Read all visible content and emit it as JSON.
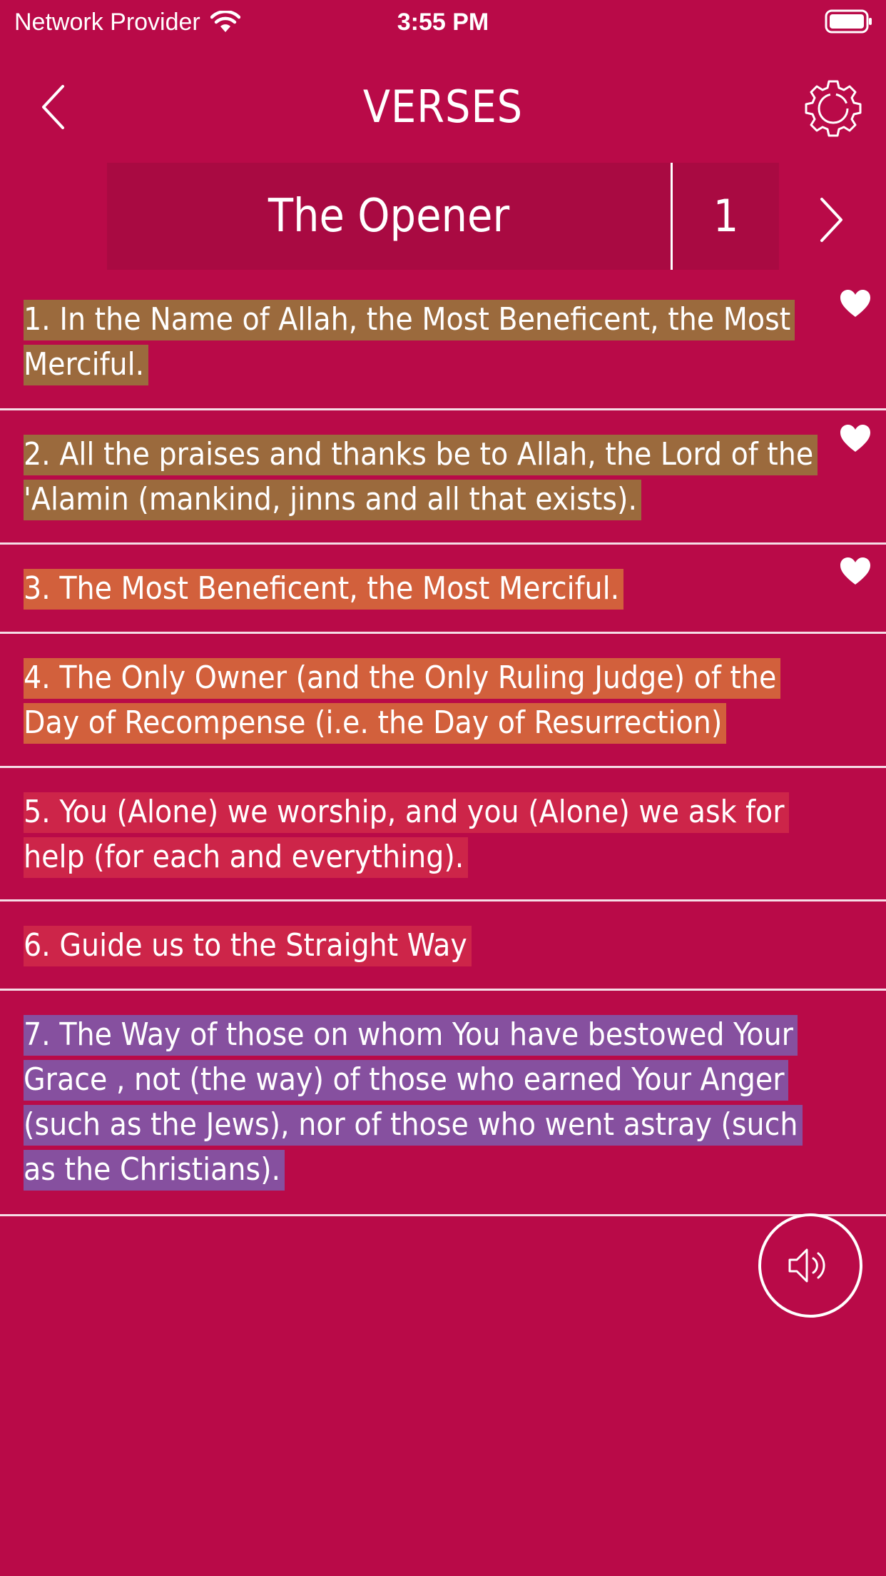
{
  "status_bar": {
    "carrier": "Network Provider",
    "time": "3:55 PM"
  },
  "nav": {
    "title": "VERSES"
  },
  "surah": {
    "name": "The Opener",
    "number": "1"
  },
  "colors": {
    "background": "#b90a48",
    "selector_background": "#a90a42",
    "highlight_brown": "#9b6a3d",
    "highlight_orange": "#d2603c",
    "highlight_red": "#cd2549",
    "highlight_purple": "#86509f",
    "divider": "#f6dde6"
  },
  "verses": [
    {
      "text": "1. In the Name of Allah, the Most Beneficent, the Most Merciful.",
      "highlight": "#9b6a3d",
      "favorite": true
    },
    {
      "text": "2. All the praises and thanks be to Allah, the Lord of the 'Alamin (mankind, jinns and all that exists).",
      "highlight": "#9b6a3d",
      "favorite": true
    },
    {
      "text": "3. The Most Beneficent, the Most Merciful.",
      "highlight": "#d2603c",
      "favorite": true
    },
    {
      "text": "4. The Only Owner (and the Only Ruling Judge) of the Day of Recompense (i.e. the Day of Resurrection)",
      "highlight": "#d2603c",
      "favorite": false
    },
    {
      "text": "5. You (Alone) we worship, and you (Alone) we ask for help (for each and everything).",
      "highlight": "#cd2549",
      "favorite": false
    },
    {
      "text": "6. Guide us to the Straight Way",
      "highlight": "#cd2549",
      "favorite": false
    },
    {
      "text": "7. The Way of those on whom You have bestowed Your Grace , not (the way) of those who earned Your Anger (such as the Jews), nor of those who went astray (such as the Christians).",
      "highlight": "#86509f",
      "favorite": false
    }
  ],
  "icons": {
    "back": "chevron-left-icon",
    "settings": "gear-icon",
    "next": "chevron-right-icon",
    "favorite": "heart-icon",
    "audio": "speaker-icon",
    "wifi": "wifi-icon",
    "battery": "battery-icon"
  }
}
